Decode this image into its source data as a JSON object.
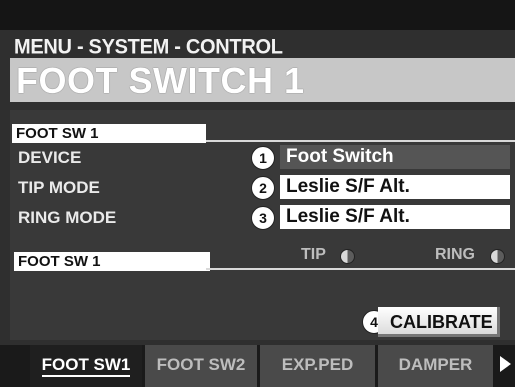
{
  "header": {
    "breadcrumb": "MENU - SYSTEM - CONTROL",
    "title": "FOOT SWITCH 1"
  },
  "section1": {
    "tag": "FOOT SW 1",
    "rows": [
      {
        "label": "DEVICE",
        "num": "1",
        "value": "Foot Switch"
      },
      {
        "label": "TIP MODE",
        "num": "2",
        "value": "Leslie S/F Alt."
      },
      {
        "label": "RING MODE",
        "num": "3",
        "value": "Leslie S/F Alt."
      }
    ]
  },
  "section2": {
    "tag": "FOOT SW 1",
    "tip_label": "TIP",
    "ring_label": "RING"
  },
  "calibrate": {
    "num": "4",
    "label": "CALIBRATE"
  },
  "tabs": [
    {
      "label": "FOOT SW1",
      "active": true
    },
    {
      "label": "FOOT SW2",
      "active": false
    },
    {
      "label": "EXP.PED",
      "active": false
    },
    {
      "label": "DAMPER",
      "active": false
    }
  ],
  "colors": {
    "selected_value_bg": "#555555",
    "title_bg": "#c7c7c7",
    "panel_bg": "#393939"
  }
}
